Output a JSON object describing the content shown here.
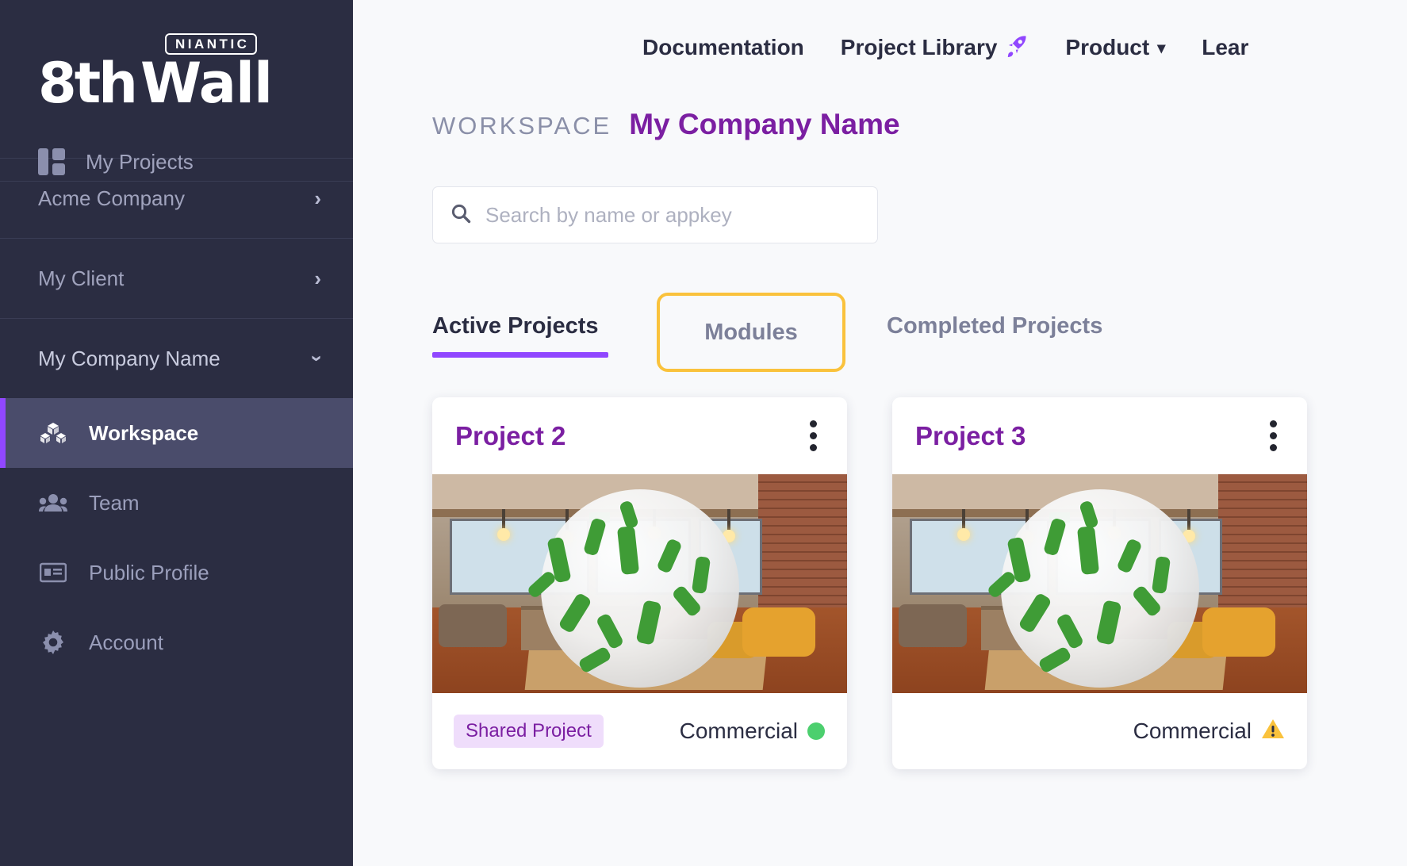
{
  "brand": {
    "badge": "NIANTIC",
    "logo_prefix": "8th",
    "logo_suffix": "Wall"
  },
  "sidebar": {
    "my_projects": {
      "label": "My Projects",
      "icon": "grid-icon"
    },
    "orgs": [
      {
        "label": "Acme Company",
        "icon": "chevron-right-icon",
        "expanded": false
      },
      {
        "label": "My Client",
        "icon": "chevron-right-icon",
        "expanded": false
      },
      {
        "label": "My Company Name",
        "icon": "chevron-down-icon",
        "expanded": true
      }
    ],
    "sub_items": [
      {
        "label": "Workspace",
        "icon": "boxes-icon",
        "active": true
      },
      {
        "label": "Team",
        "icon": "people-icon",
        "active": false
      },
      {
        "label": "Public Profile",
        "icon": "id-card-icon",
        "active": false
      },
      {
        "label": "Account",
        "icon": "gear-icon",
        "active": false
      }
    ]
  },
  "topnav": {
    "items": [
      {
        "label": "Documentation",
        "icon": null
      },
      {
        "label": "Project Library",
        "icon": "rocket-icon"
      },
      {
        "label": "Product",
        "icon": "chevron-down-icon"
      },
      {
        "label": "Lear",
        "icon": null
      }
    ]
  },
  "workspace": {
    "eyebrow": "WORKSPACE",
    "name": "My Company Name"
  },
  "search": {
    "placeholder": "Search by name or appkey",
    "value": "",
    "icon": "search-icon"
  },
  "tabs": [
    {
      "label": "Active Projects",
      "active": true,
      "highlighted": false
    },
    {
      "label": "Modules",
      "active": false,
      "highlighted": true
    },
    {
      "label": "Completed Projects",
      "active": false,
      "highlighted": false
    }
  ],
  "cards": [
    {
      "title": "Project 2",
      "menu_icon": "kebab-menu-icon",
      "badge": "Shared Project",
      "plan": "Commercial",
      "status_icon": "green-dot-icon",
      "status_glyph": ""
    },
    {
      "title": "Project 3",
      "menu_icon": "kebab-menu-icon",
      "badge": "",
      "plan": "Commercial",
      "status_icon": "warning-triangle-icon",
      "status_glyph": "⚠"
    }
  ],
  "colors": {
    "sidebar_bg": "#2b2d42",
    "accent_purple": "#9147ff",
    "title_purple": "#7b1fa2",
    "highlight_yellow": "#fac23c",
    "status_green": "#4ccf6e"
  }
}
